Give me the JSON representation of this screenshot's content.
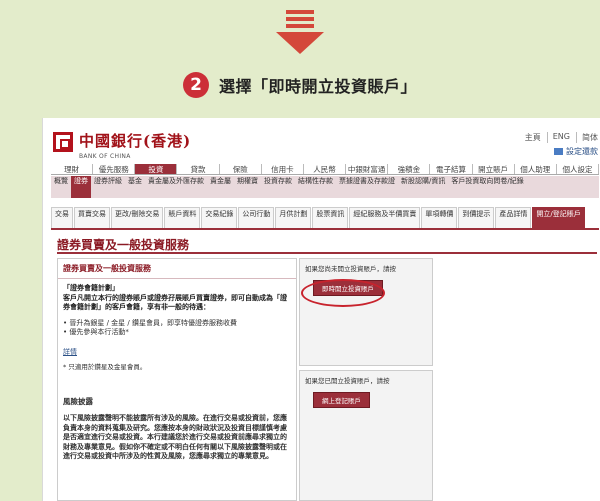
{
  "step": {
    "number": "2",
    "text": "選擇「即時開立投資賬戶」"
  },
  "header": {
    "logo_cn": "中國銀行(香港)",
    "logo_en": "BANK OF CHINA",
    "top_links": [
      "主頁",
      "ENG",
      "简体"
    ],
    "settings_link": "設定還款"
  },
  "nav1": [
    "理財",
    "優先服務",
    "投資",
    "貸款",
    "保險",
    "信用卡",
    "人民幣",
    "中銀財富通",
    "強積金",
    "電子結算",
    "開立賬戶",
    "個人助理",
    "個人設定"
  ],
  "nav1_active": 2,
  "nav2": [
    "概覽",
    "證券",
    "證券評級",
    "基金",
    "貴金屬及外匯存款",
    "貴金屬",
    "期權寶",
    "投資存款",
    "結構性存款",
    "票據證書及存款證",
    "新股認購/資訊",
    "客戶投資取向問卷/紀錄"
  ],
  "nav2_active": 1,
  "nav3": [
    "交易",
    "買賣交易",
    "更改/刪除交易",
    "賬戶資料",
    "交易紀錄",
    "公司行動",
    "月供計劃",
    "股票資訊",
    "經紀服務及半價買賣",
    "單項轉價",
    "到價提示",
    "產品詳情",
    "開立/登記賬戶"
  ],
  "nav3_active": 12,
  "page_title": "證券買賣及一般投資服務",
  "left_box": {
    "title": "證券買賣及一般投資服務",
    "plan_title": "「證券會籍計劃」",
    "plan_text": "客戶凡開立本行的證券賬戶或證券孖展賬戶買賣證券，即可自動成為「證券會籍計劃」的客戶會籍，享有非一般的待遇：",
    "bullets": [
      "晉升為銀星 / 金星 / 鑽星會員，即享特優證券服務收費",
      "優先參與本行活動*"
    ],
    "details_link": "詳情",
    "note": "* 只適用於鑽星及金星會員。",
    "risk_title": "風險披露",
    "risk_text": "以下風險披露聲明不能披露所有涉及的風險。在進行交易或投資前，您應負責本身的資料蒐集及研究。您應按本身的財政狀況及投資目標謹慎考慮是否適宜進行交易或投資。本行建議您於進行交易或投資前應尋求獨立的財務及專業意見。假如你不確定或不明白任何有關以下風險披露聲明或在進行交易或投資中所涉及的性質及風險，您應尋求獨立的專業意見。"
  },
  "right_box1": {
    "text": "如果您尚未開立投資賬戶，請按",
    "button": "即時開立投資賬戶"
  },
  "right_box2": {
    "text": "如果您已開立投資賬戶，請按",
    "button": "網上登記賬戶"
  }
}
